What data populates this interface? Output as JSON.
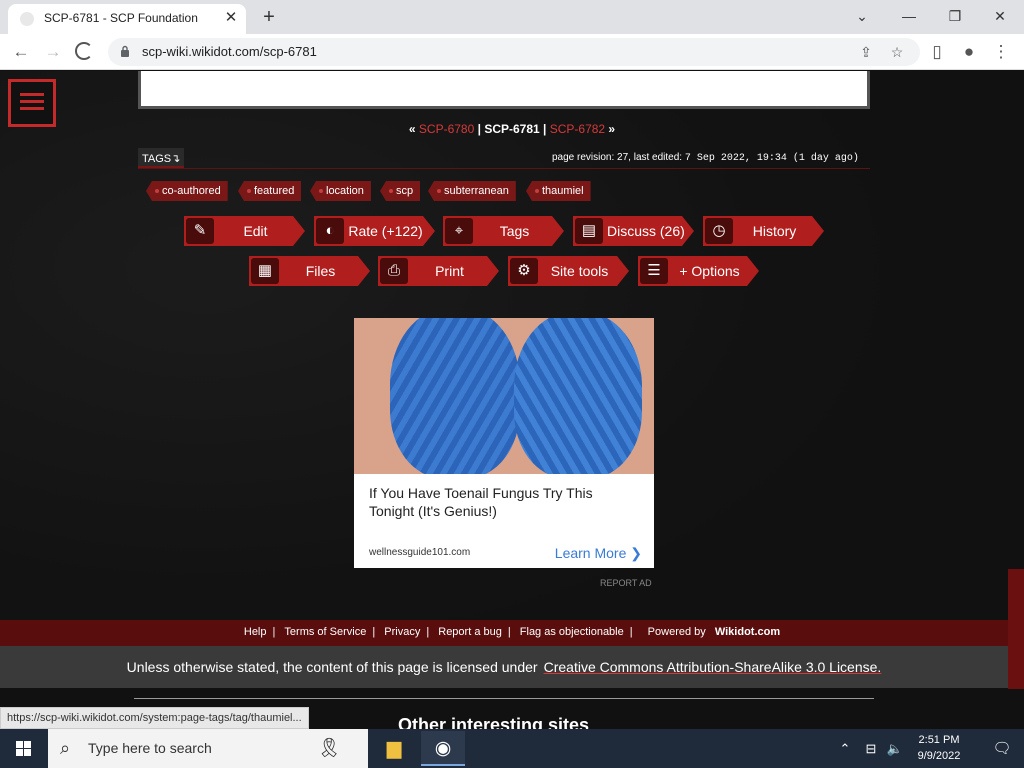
{
  "browser": {
    "tab_title": "SCP-6781 - SCP Foundation",
    "url": "scp-wiki.wikidot.com/scp-6781",
    "status_url": "https://scp-wiki.wikidot.com/system:page-tags/tag/thaumiel..."
  },
  "nav": {
    "prev_link": "SCP-6780",
    "current": "SCP-6781",
    "next_link": "SCP-6782"
  },
  "tags_label": "TAGS",
  "revision": {
    "text": "page revision: 27, last edited:",
    "date": "7 Sep 2022, 19:34 (1 day ago)"
  },
  "tags": [
    "co-authored",
    "featured",
    "location",
    "scp",
    "subterranean",
    "thaumiel"
  ],
  "actions": {
    "edit": "Edit",
    "rate": "Rate (+122)",
    "tags": "Tags",
    "discuss": "Discuss (26)",
    "history": "History",
    "files": "Files",
    "print": "Print",
    "site_tools": "Site tools",
    "options": "+ Options"
  },
  "ad": {
    "headline": "If You Have Toenail Fungus Try This Tonight (It's Genius!)",
    "domain": "wellnessguide101.com",
    "cta": "Learn More",
    "report": "REPORT AD"
  },
  "footer": {
    "links": [
      "Help",
      "Terms of Service",
      "Privacy",
      "Report a bug",
      "Flag as objectionable"
    ],
    "powered_by": "Powered by",
    "powered_name": "Wikidot.com",
    "license_text": "Unless otherwise stated, the content of this page is licensed under",
    "license_link": "Creative Commons Attribution-ShareAlike 3.0 License.",
    "other_sites": "Other interesting sites"
  },
  "taskbar": {
    "search_placeholder": "Type here to search",
    "time": "2:51 PM",
    "date": "9/9/2022"
  },
  "colors": {
    "accent": "#b01e1e",
    "link": "#d63a3a",
    "tag_bg": "#7a1717"
  }
}
